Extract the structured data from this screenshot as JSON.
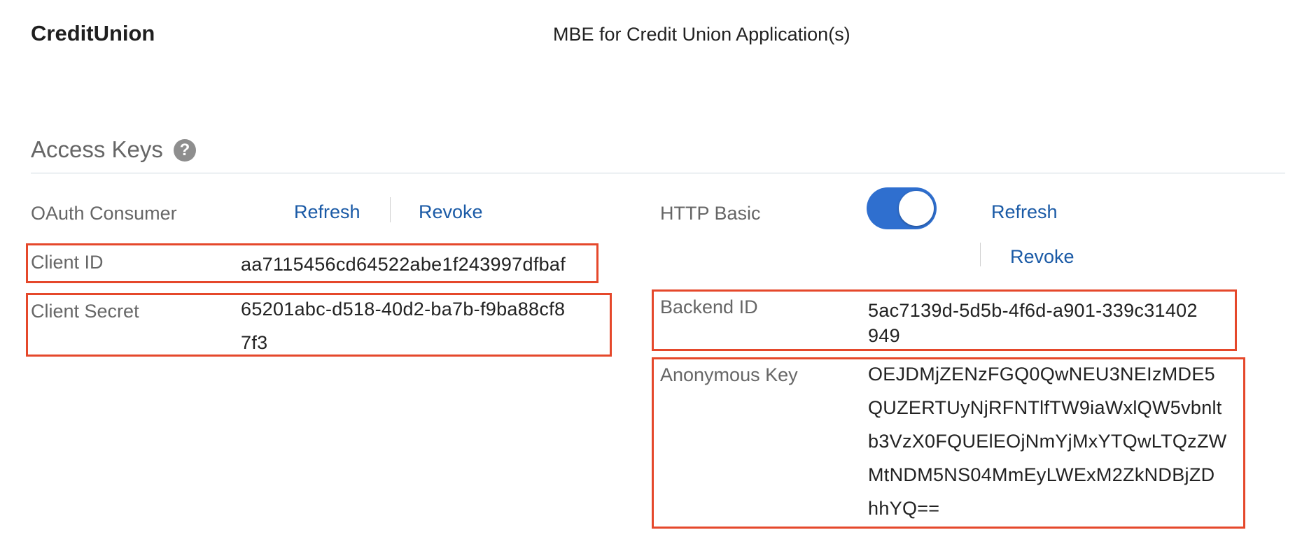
{
  "header": {
    "app_name": "CreditUnion",
    "page_title": "MBE for Credit Union Application(s)"
  },
  "access_keys": {
    "title": "Access Keys",
    "help_icon": "?"
  },
  "oauth": {
    "label": "OAuth Consumer",
    "refresh_label": "Refresh",
    "revoke_label": "Revoke",
    "client_id_label": "Client ID",
    "client_id_value": "aa7115456cd64522abe1f243997dfbaf",
    "client_secret_label": "Client Secret",
    "client_secret_lines": [
      "65201abc-d518-40d2-ba7b-f9ba88cf8",
      "7f3"
    ]
  },
  "http_basic": {
    "label": "HTTP Basic",
    "toggle_state": "on",
    "refresh_label": "Refresh",
    "revoke_label": "Revoke",
    "backend_id_label": "Backend ID",
    "backend_id_lines": [
      "5ac7139d-5d5b-4f6d-a901-339c31402",
      "949"
    ],
    "anonymous_key_label": "Anonymous Key",
    "anonymous_key_lines": [
      "OEJDMjZENzFGQ0QwNEU3NEIzMDE5",
      "QUZERTUyNjRFNTlfTW9iaWxlQW5vbnlt",
      "b3VzX0FQUElEOjNmYjMxYTQwLTQzZW",
      "MtNDM5NS04MmEyLWExM2ZkNDBjZD",
      "hhYQ=="
    ]
  },
  "colors": {
    "accent": "#1a5aa6",
    "toggle_on": "#2f6fcf",
    "highlight": "#e5482b"
  },
  "icons": {
    "help": "help-icon"
  }
}
